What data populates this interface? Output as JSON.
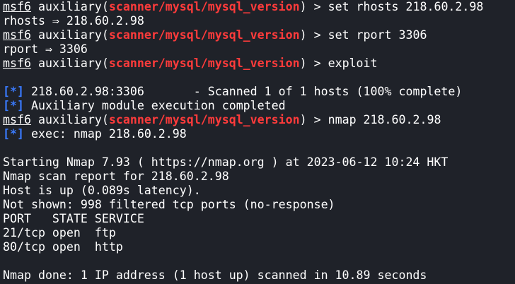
{
  "terminal": {
    "prompt": {
      "msf": "msf6",
      "aux_before": "auxiliary(",
      "module": "scanner/mysql/mysql_version",
      "aux_after": ") > "
    },
    "commands": {
      "c1": "set rhosts 218.60.2.98",
      "c2": "set rport 3306",
      "c3": "exploit",
      "c4": "nmap 218.60.2.98"
    },
    "outputs": {
      "rhosts_echo": "rhosts ⇒ 218.60.2.98",
      "rport_echo": "rport ⇒ 3306",
      "scan_marker": "[*]",
      "scan_msg": " 218.60.2.98:3306       - Scanned 1 of 1 hosts (100% complete)",
      "done_marker": "[*]",
      "done_msg": " Auxiliary module execution completed",
      "exec_marker": "[*]",
      "exec_msg": " exec: nmap 218.60.2.98"
    },
    "nmap": {
      "start": "Starting Nmap 7.93 ( https://nmap.org ) at 2023-06-12 10:24 HKT",
      "report": "Nmap scan report for 218.60.2.98",
      "host_up": "Host is up (0.089s latency).",
      "not_shown": "Not shown: 998 filtered tcp ports (no-response)",
      "header": "PORT   STATE SERVICE",
      "ports": [
        "21/tcp open  ftp",
        "80/tcp open  http"
      ],
      "done": "Nmap done: 1 IP address (1 host up) scanned in 10.89 seconds"
    }
  },
  "colors": {
    "background": "#1f2229",
    "text": "#ffffff",
    "module": "#ff3b3b",
    "info": "#3a7bff"
  }
}
